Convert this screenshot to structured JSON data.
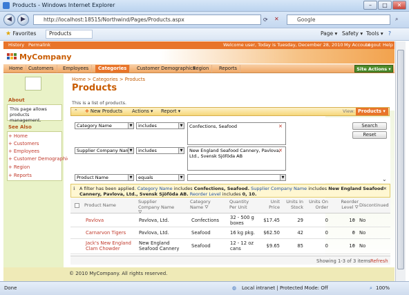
{
  "window": {
    "title": "Products - Windows Internet Explorer"
  },
  "address": {
    "url": "http://localhost:18515/Northwind/Pages/Products.aspx",
    "search_placeholder": "Google"
  },
  "favorites": {
    "favorites_label": "Favorites",
    "tab_label": "Products",
    "page_label": "Page",
    "safety_label": "Safety",
    "tools_label": "Tools"
  },
  "topstrip": {
    "history": "History",
    "permalink": "Permalink",
    "welcome": "Welcome user, Today is Tuesday, December 28, 2010",
    "my_account": "My Account",
    "logout": "Logout",
    "help": "Help"
  },
  "brand": {
    "name": "MyCompany"
  },
  "menu": {
    "items": [
      "Home",
      "Customers",
      "Employees",
      "Categories",
      "Customer Demographics",
      "Region",
      "Reports"
    ],
    "site_actions": "Site Actions"
  },
  "sidebar": {
    "about_title": "About",
    "about_text": "This page allows products management.",
    "see_also_title": "See Also",
    "links": [
      "Home",
      "Customers",
      "Employees",
      "Customer Demographics",
      "Region",
      "Reports"
    ]
  },
  "main": {
    "breadcrumb": "Home > Categories > Products",
    "title": "Products",
    "description": "This is a list of products."
  },
  "toolbar": {
    "new": "New Products",
    "actions": "Actions",
    "report": "Report",
    "view_label": "View:",
    "view_value": "Products"
  },
  "filters": [
    {
      "field": "Category Name",
      "op": "includes",
      "value": "Confections, Seafood"
    },
    {
      "field": "Supplier Company Name",
      "op": "includes",
      "value": "New England Seafood Cannery, Pavlova, Ltd., Svensk Sjöföda AB"
    },
    {
      "field": "Product Name",
      "op": "equals",
      "value": ""
    }
  ],
  "buttons": {
    "search": "Search",
    "reset": "Reset"
  },
  "filterinfo": {
    "prefix": "A filter has been applied.",
    "f1_field": "Category Name",
    "f1_op": "includes",
    "f1_val": "Confections, Seafood.",
    "f2_field": "Supplier Company Name",
    "f2_op": "includes",
    "f2_val": "New England Seafood Cannery, Pavlova, Ltd., Svensk Sjöföda AB.",
    "f3_field": "Reorder Level",
    "f3_op": "includes",
    "f3_val": "0, 10."
  },
  "grid": {
    "headers": [
      "Product Name",
      "Supplier Company Name",
      "Category Name",
      "Quantity Per Unit",
      "Unit Price",
      "Units In Stock",
      "Units On Order",
      "Reorder Level",
      "Discontinued"
    ],
    "rows": [
      {
        "product": "Pavlova",
        "supplier": "Pavlova, Ltd.",
        "category": "Confections",
        "qty": "32 - 500 g boxes",
        "price": "$17.45",
        "stock": "29",
        "order": "0",
        "reorder": "10",
        "disc": "No"
      },
      {
        "product": "Carnarvon Tigers",
        "supplier": "Pavlova, Ltd.",
        "category": "Seafood",
        "qty": "16 kg pkg.",
        "price": "$62.50",
        "stock": "42",
        "order": "0",
        "reorder": "0",
        "disc": "No"
      },
      {
        "product": "Jack's New England Clam Chowder",
        "supplier": "New England Seafood Cannery",
        "category": "Seafood",
        "qty": "12 - 12 oz cans",
        "price": "$9.65",
        "stock": "85",
        "order": "0",
        "reorder": "10",
        "disc": "No"
      }
    ],
    "pager": "Showing 1-3 of 3 items",
    "refresh": "Refresh"
  },
  "footer": {
    "text": "© 2010 MyCompany. All rights reserved."
  },
  "status": {
    "left": "Done",
    "zone": "Local intranet | Protected Mode: Off",
    "zoom": "100%"
  },
  "colors": {
    "accent": "#e8742a",
    "site_actions": "#4d8a2a",
    "link": "#c0392b"
  }
}
